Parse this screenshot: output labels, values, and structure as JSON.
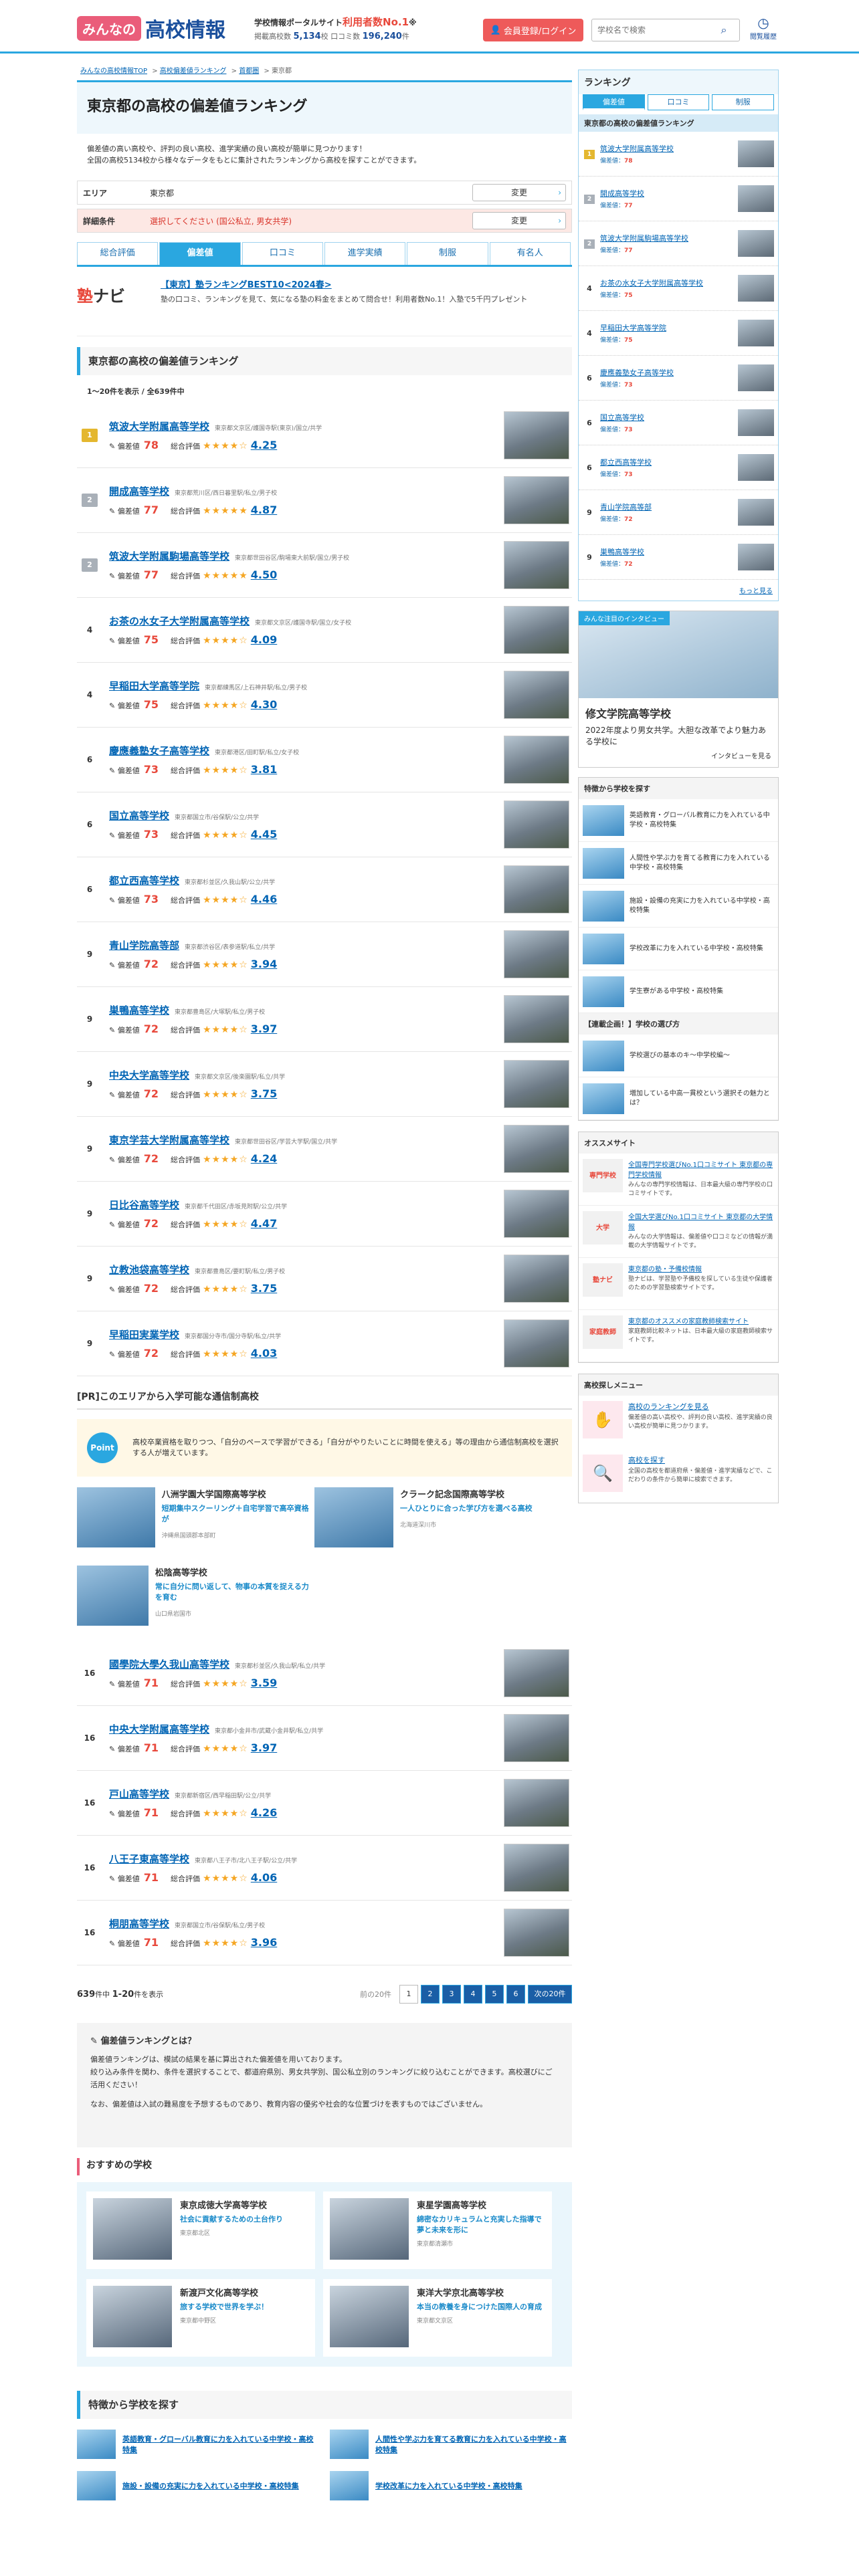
{
  "header": {
    "logo_badge": "みんなの",
    "logo_text": "高校情報",
    "tagline_pre": "学校情報ポータルサイト",
    "tagline_hl": "利用者数No.1",
    "tagline_note": "※",
    "stats_label1": "掲載高校数",
    "stats_val1": "5,134",
    "stats_unit1": "校",
    "stats_label2": "口コミ数",
    "stats_val2": "196,240",
    "stats_unit2": "件",
    "login": "会員登録/ログイン",
    "search_placeholder": "学校名で検索",
    "history": "閲覧履歴"
  },
  "breadcrumb": [
    "みんなの高校情報TOP",
    "高校偏差値ランキング",
    "首都圏",
    "東京都"
  ],
  "page": {
    "title": "東京都の高校の偏差値ランキング",
    "desc1": "偏差値の高い高校や、評判の良い高校、進学実績の良い高校が簡単に見つかります！",
    "desc2": "全国の高校5134校から様々なデータをもとに集計されたランキングから高校を探すことができます。"
  },
  "filters": [
    {
      "label": "エリア",
      "value": "東京都",
      "btn": "変更"
    },
    {
      "label": "詳細条件",
      "value": "選択してください (国公私立, 男女共学)",
      "btn": "変更"
    }
  ],
  "tabs": [
    "総合評価",
    "偏差値",
    "口コミ",
    "進学実績",
    "制服",
    "有名人"
  ],
  "ad": {
    "logo1": "塾",
    "logo2": "ナビ",
    "title": "【東京】塾ランキングBEST10<2024春>",
    "desc": "塾の口コミ、ランキングを見て、気になる塾の料金をまとめて問合せ！利用者数No.1！入塾で5千円プレゼント"
  },
  "section_title": "東京都の高校の偏差値ランキング",
  "count": "1〜20件を表示 / 全639件中",
  "dev_label": "偏差値",
  "review_label": "総合評価",
  "rows": [
    {
      "rank": "1",
      "crown": "gold",
      "name": "筑波大学附属高等学校",
      "addr": "東京都文京区/護国寺駅(東京)/国立/共学",
      "dev": "78",
      "score": "4.25",
      "stars": "★★★★☆"
    },
    {
      "rank": "2",
      "crown": "silver",
      "name": "開成高等学校",
      "addr": "東京都荒川区/西日暮里駅/私立/男子校",
      "dev": "77",
      "score": "4.87",
      "stars": "★★★★★"
    },
    {
      "rank": "2",
      "crown": "silver",
      "name": "筑波大学附属駒場高等学校",
      "addr": "東京都世田谷区/駒場東大前駅/国立/男子校",
      "dev": "77",
      "score": "4.50",
      "stars": "★★★★★"
    },
    {
      "rank": "4",
      "crown": "",
      "name": "お茶の水女子大学附属高等学校",
      "addr": "東京都文京区/護国寺駅/国立/女子校",
      "dev": "75",
      "score": "4.09",
      "stars": "★★★★☆"
    },
    {
      "rank": "4",
      "crown": "",
      "name": "早稲田大学高等学院",
      "addr": "東京都練馬区/上石神井駅/私立/男子校",
      "dev": "75",
      "score": "4.30",
      "stars": "★★★★☆"
    },
    {
      "rank": "6",
      "crown": "",
      "name": "慶應義塾女子高等学校",
      "addr": "東京都港区/田町駅/私立/女子校",
      "dev": "73",
      "score": "3.81",
      "stars": "★★★★☆"
    },
    {
      "rank": "6",
      "crown": "",
      "name": "国立高等学校",
      "addr": "東京都国立市/谷保駅/公立/共学",
      "dev": "73",
      "score": "4.45",
      "stars": "★★★★☆"
    },
    {
      "rank": "6",
      "crown": "",
      "name": "都立西高等学校",
      "addr": "東京都杉並区/久我山駅/公立/共学",
      "dev": "73",
      "score": "4.46",
      "stars": "★★★★☆"
    },
    {
      "rank": "9",
      "crown": "",
      "name": "青山学院高等部",
      "addr": "東京都渋谷区/表参道駅/私立/共学",
      "dev": "72",
      "score": "3.94",
      "stars": "★★★★☆"
    },
    {
      "rank": "9",
      "crown": "",
      "name": "巣鴨高等学校",
      "addr": "東京都豊島区/大塚駅/私立/男子校",
      "dev": "72",
      "score": "3.97",
      "stars": "★★★★☆"
    },
    {
      "rank": "9",
      "crown": "",
      "name": "中央大学高等学校",
      "addr": "東京都文京区/後楽園駅/私立/共学",
      "dev": "72",
      "score": "3.75",
      "stars": "★★★★☆"
    },
    {
      "rank": "9",
      "crown": "",
      "name": "東京学芸大学附属高等学校",
      "addr": "東京都世田谷区/学芸大学駅/国立/共学",
      "dev": "72",
      "score": "4.24",
      "stars": "★★★★☆"
    },
    {
      "rank": "9",
      "crown": "",
      "name": "日比谷高等学校",
      "addr": "東京都千代田区/赤坂見附駅/公立/共学",
      "dev": "72",
      "score": "4.47",
      "stars": "★★★★☆"
    },
    {
      "rank": "9",
      "crown": "",
      "name": "立教池袋高等学校",
      "addr": "東京都豊島区/要町駅/私立/男子校",
      "dev": "72",
      "score": "3.75",
      "stars": "★★★★☆"
    },
    {
      "rank": "9",
      "crown": "",
      "name": "早稲田実業学校",
      "addr": "東京都国分寺市/国分寺駅/私立/共学",
      "dev": "72",
      "score": "4.03",
      "stars": "★★★★☆"
    },
    {
      "rank": "16",
      "crown": "",
      "name": "國學院大學久我山高等学校",
      "addr": "東京都杉並区/久我山駅/私立/共学",
      "dev": "71",
      "score": "3.59",
      "stars": "★★★★☆"
    },
    {
      "rank": "16",
      "crown": "",
      "name": "中央大学附属高等学校",
      "addr": "東京都小金井市/武蔵小金井駅/私立/共学",
      "dev": "71",
      "score": "3.97",
      "stars": "★★★★☆"
    },
    {
      "rank": "16",
      "crown": "",
      "name": "戸山高等学校",
      "addr": "東京都新宿区/西早稲田駅/公立/共学",
      "dev": "71",
      "score": "4.26",
      "stars": "★★★★☆"
    },
    {
      "rank": "16",
      "crown": "",
      "name": "八王子東高等学校",
      "addr": "東京都八王子市/北八王子駅/公立/共学",
      "dev": "71",
      "score": "4.06",
      "stars": "★★★★☆"
    },
    {
      "rank": "16",
      "crown": "",
      "name": "桐朋高等学校",
      "addr": "東京都国立市/谷保駅/私立/男子校",
      "dev": "71",
      "score": "3.96",
      "stars": "★★★★☆"
    }
  ],
  "pr": {
    "title": "[PR]このエリアから入学可能な通信制高校",
    "point": "Point",
    "text": "高校卒業資格を取りつつ、「自分のペースで学習ができる」「自分がやりたいことに時間を使える」等の理由から通信制高校を選択する人が増えています。",
    "cards": [
      {
        "name": "八洲学園大学国際高等学校",
        "catch": "短期集中スクーリング＋自宅学習で高卒資格が",
        "addr": "沖縄県国頭郡本部町"
      },
      {
        "name": "クラーク記念国際高等学校",
        "catch": "一人ひとりに合った学び方を選べる高校",
        "addr": "北海道深川市"
      },
      {
        "name": "松陰高等学校",
        "catch": "常に自分に問い返して、物事の本質を捉える力を育む",
        "addr": "山口県岩国市"
      }
    ]
  },
  "pager": {
    "total": "639",
    "range": "1-20",
    "total_suffix": "件中",
    "range_suffix": "件を表示",
    "prev": "前の20件",
    "pages": [
      "1",
      "2",
      "3",
      "4",
      "5",
      "6"
    ],
    "next": "次の20件"
  },
  "about": {
    "title": "偏差値ランキングとは？",
    "p1": "偏差値ランキングは、模試の結果を基に算出された偏差値を用いております。",
    "p2": "絞り込み条件を関わ、条件を選択することで、都道府県別、男女共学別、国公私立別のランキングに絞り込むことができます。高校選びにご活用ください！",
    "p3": "なお、偏差値は入試の難易度を予想するものであり、教育内容の優劣や社会的な位置づけを表すものではございません。"
  },
  "recommend": {
    "title": "おすすめの学校",
    "items": [
      {
        "name": "東京成徳大学高等学校",
        "catch": "社会に貢献するための土台作り",
        "addr": "東京都北区"
      },
      {
        "name": "東星学園高等学校",
        "catch": "綿密なカリキュラムと充実した指導で夢と未来を形に",
        "addr": "東京都清瀬市"
      },
      {
        "name": "新渡戸文化高等学校",
        "catch": "旅する学校で世界を学ぶ！",
        "addr": "東京都中野区"
      },
      {
        "name": "東洋大学京北高等学校",
        "catch": "本当の教養を身につけた国際人の育成",
        "addr": "東京都文京区"
      }
    ]
  },
  "features": {
    "title": "特徴から学校を探す",
    "items": [
      "英語教育・グローバル教育に力を入れている中学校・高校特集",
      "人間性や学ぶ力を育てる教育に力を入れている中学校・高校特集",
      "施設・設備の充実に力を入れている中学校・高校特集",
      "学校改革に力を入れている中学校・高校特集"
    ]
  },
  "side": {
    "rank_title": "ランキング",
    "tabs": [
      "偏差値",
      "口コミ",
      "制服"
    ],
    "sub": "東京都の高校の偏差値ランキング",
    "dev_label": "偏差値：",
    "items": [
      {
        "rank": "1",
        "crown": "gold",
        "name": "筑波大学附属高等学校",
        "dev": "78"
      },
      {
        "rank": "2",
        "crown": "silver",
        "name": "開成高等学校",
        "dev": "77"
      },
      {
        "rank": "2",
        "crown": "silver",
        "name": "筑波大学附属駒場高等学校",
        "dev": "77"
      },
      {
        "rank": "4",
        "crown": "",
        "name": "お茶の水女子大学附属高等学校",
        "dev": "75"
      },
      {
        "rank": "4",
        "crown": "",
        "name": "早稲田大学高等学院",
        "dev": "75"
      },
      {
        "rank": "6",
        "crown": "",
        "name": "慶應義塾女子高等学校",
        "dev": "73"
      },
      {
        "rank": "6",
        "crown": "",
        "name": "国立高等学校",
        "dev": "73"
      },
      {
        "rank": "6",
        "crown": "",
        "name": "都立西高等学校",
        "dev": "73"
      },
      {
        "rank": "9",
        "crown": "",
        "name": "青山学院高等部",
        "dev": "72"
      },
      {
        "rank": "9",
        "crown": "",
        "name": "巣鴨高等学校",
        "dev": "72"
      }
    ],
    "more": "もっと見る",
    "interview": {
      "label": "みんな注目のインタビュー",
      "name": "修文学院高等学校",
      "desc": "2022年度より男女共学。大胆な改革でより魅力ある学校に",
      "more": "インタビューを見る"
    },
    "feat_title": "特徴から学校を探す",
    "feats": [
      "英語教育・グローバル教育に力を入れている中学校・高校特集",
      "人間性や学ぶ力を育てる教育に力を入れている中学校・高校特集",
      "施設・設備の充実に力を入れている中学校・高校特集",
      "学校改革に力を入れている中学校・高校特集",
      "学生寮がある中学校・高校特集"
    ],
    "plan_title": "【連載企画！】学校の選び方",
    "plans": [
      "学校選びの基本のキ〜中学校編〜",
      "増加している中高一貫校という選択その魅力とは？"
    ],
    "osu_title": "オススメサイト",
    "osu": [
      {
        "icon": "専門学校",
        "link": "全国専門学校選びNo.1口コミサイト 東京都の専門学校情報",
        "d": "みんなの専門学校情報は、日本最大級の専門学校の口コミサイトです。"
      },
      {
        "icon": "大学",
        "link": "全国大学選びNo.1口コミサイト 東京都の大学情報",
        "d": "みんなの大学情報は、偏差値や口コミなどの情報が満載の大学情報サイトです。"
      },
      {
        "icon": "塾ナビ",
        "link": "東京都の塾・予備校情報",
        "d": "塾ナビは、学習塾や予備校を探している生徒や保護者のための学習塾検索サイトです。"
      },
      {
        "icon": "家庭教師",
        "link": "東京都のオススメの家庭教師検索サイト",
        "d": "家庭教師比較ネットは、日本最大級の家庭教師検索サイトです。"
      }
    ],
    "hm_title": "高校探しメニュー",
    "hm": [
      {
        "icon": "✋",
        "link": "高校のランキングを見る",
        "d": "偏差値の高い高校や、評判の良い高校、進学実績の良い高校が簡単に見つかります。"
      },
      {
        "icon": "🔍",
        "link": "高校を探す",
        "d": "全国の高校を都道府県・偏差値・進学実績などで、こだわりの条件から簡単に検索できます。"
      }
    ]
  },
  "colors": {
    "brand": "#1a4f9c",
    "accent": "#2aa7e0",
    "red": "#e8483b"
  }
}
